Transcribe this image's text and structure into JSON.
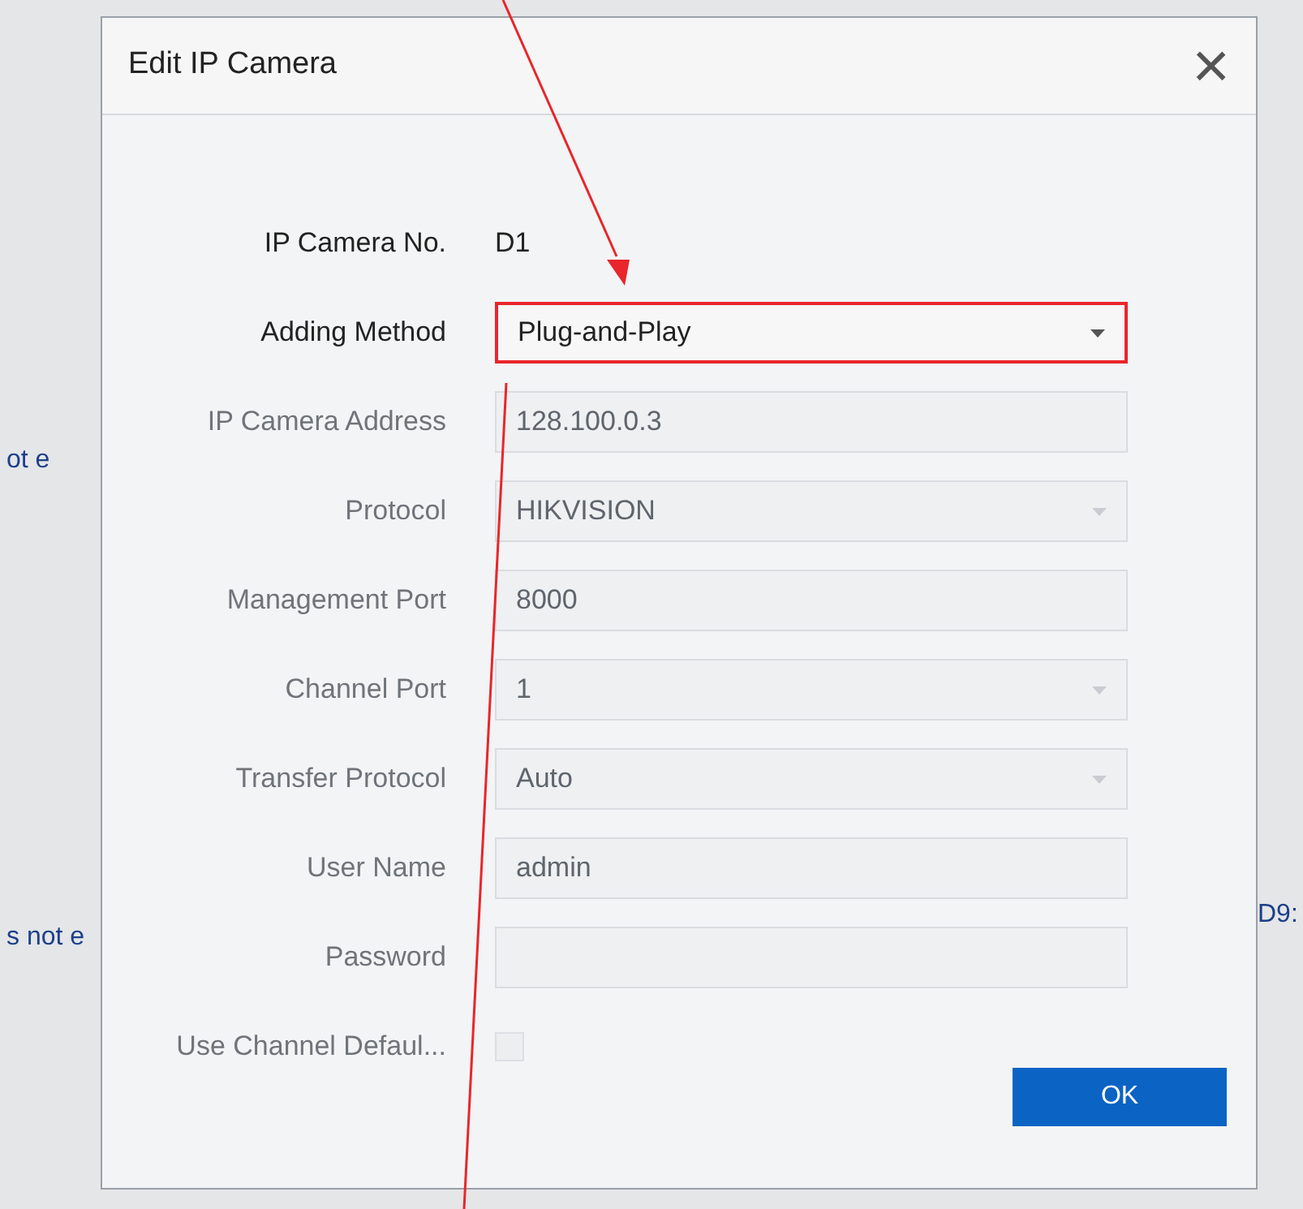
{
  "background_texts": {
    "left": [
      "ot e",
      "s not e"
    ],
    "right": [
      "D9:"
    ]
  },
  "dialog": {
    "title": "Edit IP Camera",
    "close_icon": "×",
    "fields": [
      {
        "label": "IP Camera No.",
        "kind": "static",
        "value": "D1"
      },
      {
        "label": "Adding Method",
        "kind": "select",
        "value": "Plug-and-Play",
        "disabled": false,
        "highlighted": true
      },
      {
        "label": "IP Camera Address",
        "kind": "text",
        "value": "128.100.0.3",
        "disabled": true
      },
      {
        "label": "Protocol",
        "kind": "select",
        "value": "HIKVISION",
        "disabled": true
      },
      {
        "label": "Management Port",
        "kind": "text",
        "value": "8000",
        "disabled": true
      },
      {
        "label": "Channel Port",
        "kind": "select",
        "value": "1",
        "disabled": true
      },
      {
        "label": "Transfer Protocol",
        "kind": "select",
        "value": "Auto",
        "disabled": true
      },
      {
        "label": "User Name",
        "kind": "text",
        "value": "admin",
        "disabled": true
      },
      {
        "label": "Password",
        "kind": "password",
        "disabled": true
      },
      {
        "label": "Use Channel Defaul...",
        "kind": "checkbox",
        "disabled": true
      }
    ],
    "buttons": [
      {
        "label": "OK"
      }
    ]
  }
}
